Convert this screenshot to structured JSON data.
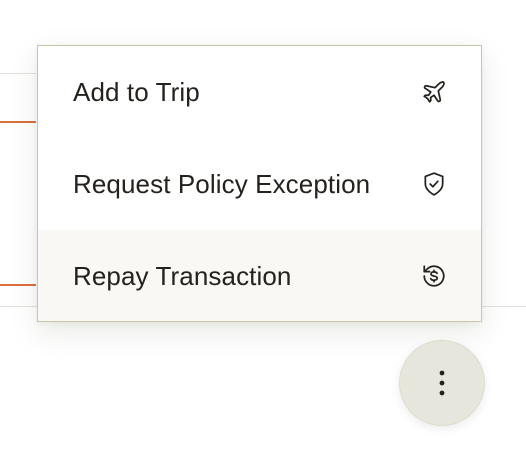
{
  "menu": {
    "items": [
      {
        "label": "Add to Trip",
        "icon": "airplane-icon"
      },
      {
        "label": "Request Policy Exception",
        "icon": "shield-check-icon"
      },
      {
        "label": "Repay Transaction",
        "icon": "repay-dollar-icon",
        "hovered": true
      }
    ]
  },
  "more_button": {
    "icon": "more-vertical-icon"
  },
  "colors": {
    "menu_border": "#c7c7a6",
    "text": "#25221e",
    "hover_bg": "#faf8f5",
    "fab_bg": "#e7e6dc",
    "accent": "#d9703e"
  }
}
